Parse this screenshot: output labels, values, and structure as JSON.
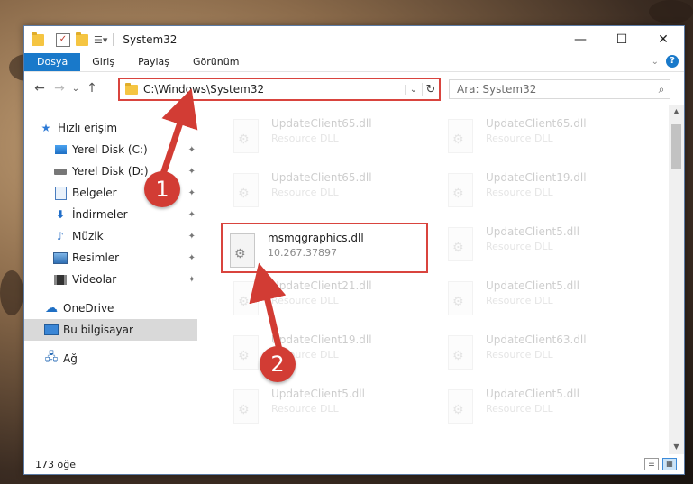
{
  "window": {
    "title": "System32",
    "controls": {
      "minimize": "—",
      "maximize": "☐",
      "close": "✕"
    }
  },
  "ribbon": {
    "tabs": [
      "Dosya",
      "Giriş",
      "Paylaş",
      "Görünüm"
    ],
    "help": "?",
    "expand": "⌄"
  },
  "nav": {
    "back": "←",
    "forward": "→",
    "recent": "⌄",
    "up": "↑",
    "address": "C:\\Windows\\System32",
    "address_dropdown": "⌄",
    "refresh": "↻",
    "search_placeholder": "Ara: System32",
    "search_icon": "⌕"
  },
  "sidebar": {
    "quick_access": "Hızlı erişim",
    "items": [
      {
        "label": "Yerel Disk (C:)",
        "icon": "windows-disk-icon"
      },
      {
        "label": "Yerel Disk (D:)",
        "icon": "disk-icon"
      },
      {
        "label": "Belgeler",
        "icon": "documents-icon"
      },
      {
        "label": "İndirmeler",
        "icon": "downloads-icon"
      },
      {
        "label": "Müzik",
        "icon": "music-icon"
      },
      {
        "label": "Resimler",
        "icon": "pictures-icon"
      },
      {
        "label": "Videolar",
        "icon": "videos-icon"
      }
    ],
    "pin": "📌",
    "onedrive": "OneDrive",
    "this_pc": "Bu bilgisayar",
    "network": "Ağ"
  },
  "files": [
    {
      "name": "UpdateClient65.dll",
      "sub": "Resource DLL"
    },
    {
      "name": "UpdateClient65.dll",
      "sub": "Resource DLL"
    },
    {
      "name": "UpdateClient65.dll",
      "sub": "Resource DLL"
    },
    {
      "name": "UpdateClient19.dll",
      "sub": "Resource DLL"
    },
    {
      "name": "msmqgraphics.dll",
      "sub": "10.267.37897"
    },
    {
      "name": "UpdateClient5.dll",
      "sub": "Resource DLL"
    },
    {
      "name": "UpdateClient21.dll",
      "sub": "Resource DLL"
    },
    {
      "name": "UpdateClient5.dll",
      "sub": "Resource DLL"
    },
    {
      "name": "UpdateClient19.dll",
      "sub": "Resource DLL"
    },
    {
      "name": "UpdateClient63.dll",
      "sub": "Resource DLL"
    },
    {
      "name": "UpdateClient5.dll",
      "sub": "Resource DLL"
    },
    {
      "name": "UpdateClient5.dll",
      "sub": "Resource DLL"
    }
  ],
  "status": {
    "count": "173 öğe"
  },
  "callouts": {
    "one": "1",
    "two": "2"
  },
  "colors": {
    "accent": "#1979ca",
    "highlight": "#d9443e",
    "callout": "#d23c34"
  }
}
